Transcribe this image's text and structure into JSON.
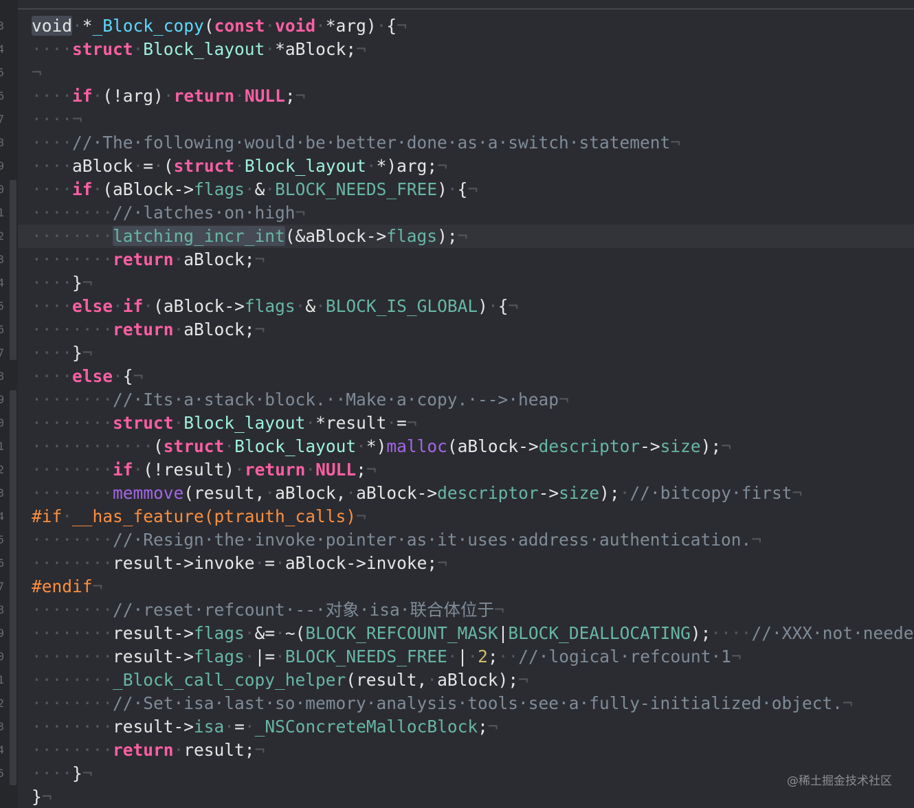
{
  "gutter_numbers": [
    "3",
    "4",
    "5",
    "6",
    "7",
    "8",
    "9",
    "0",
    "1",
    "2",
    "3",
    "4",
    "5",
    "6",
    "7",
    "8",
    "9",
    "0",
    "1",
    "2",
    "3",
    "4",
    "5",
    "6",
    "7",
    "8",
    "9",
    "0",
    "1",
    "2",
    "3",
    "4",
    "5"
  ],
  "current_line_index": 9,
  "code_lines": [
    [
      [
        "pl",
        "void",
        1
      ],
      [
        "ws",
        "·"
      ],
      [
        "pl",
        "*"
      ],
      [
        "ty",
        "_Block_copy"
      ],
      [
        "pl",
        "("
      ],
      [
        "kw",
        "const"
      ],
      [
        "ws",
        "·"
      ],
      [
        "kw",
        "void"
      ],
      [
        "ws",
        "·"
      ],
      [
        "pl",
        "*arg)"
      ],
      [
        "ws",
        "·"
      ],
      [
        "pl",
        "{"
      ],
      [
        "ws",
        "¬"
      ]
    ],
    [
      [
        "ws",
        "····"
      ],
      [
        "kw",
        "struct"
      ],
      [
        "ws",
        "·"
      ],
      [
        "tyc",
        "Block_layout"
      ],
      [
        "ws",
        "·"
      ],
      [
        "pl",
        "*aBlock;"
      ],
      [
        "ws",
        "¬"
      ]
    ],
    [
      [
        "ws",
        "¬"
      ]
    ],
    [
      [
        "ws",
        "····"
      ],
      [
        "kw",
        "if"
      ],
      [
        "ws",
        "·"
      ],
      [
        "pl",
        "(!arg)"
      ],
      [
        "ws",
        "·"
      ],
      [
        "kw",
        "return"
      ],
      [
        "ws",
        "·"
      ],
      [
        "kw",
        "NULL"
      ],
      [
        "pl",
        ";"
      ],
      [
        "ws",
        "¬"
      ]
    ],
    [
      [
        "ws",
        "····¬"
      ]
    ],
    [
      [
        "ws",
        "····"
      ],
      [
        "cm",
        "//·The·following·would·be·better·done·as·a·switch·statement"
      ],
      [
        "ws",
        "¬"
      ]
    ],
    [
      [
        "ws",
        "····"
      ],
      [
        "pl",
        "aBlock"
      ],
      [
        "ws",
        "·"
      ],
      [
        "pl",
        "="
      ],
      [
        "ws",
        "·"
      ],
      [
        "pl",
        "("
      ],
      [
        "kw",
        "struct"
      ],
      [
        "ws",
        "·"
      ],
      [
        "tyc",
        "Block_layout"
      ],
      [
        "ws",
        "·"
      ],
      [
        "pl",
        "*)arg;"
      ],
      [
        "ws",
        "¬"
      ]
    ],
    [
      [
        "ws",
        "····"
      ],
      [
        "kw",
        "if"
      ],
      [
        "ws",
        "·"
      ],
      [
        "pl",
        "(aBlock->"
      ],
      [
        "fld",
        "flags"
      ],
      [
        "ws",
        "·"
      ],
      [
        "pl",
        "&"
      ],
      [
        "ws",
        "·"
      ],
      [
        "mac",
        "BLOCK_NEEDS_FREE"
      ],
      [
        "pl",
        ")"
      ],
      [
        "ws",
        "·"
      ],
      [
        "pl",
        "{"
      ],
      [
        "ws",
        "¬"
      ]
    ],
    [
      [
        "ws",
        "········"
      ],
      [
        "cm",
        "//·latches·on·high"
      ],
      [
        "ws",
        "¬"
      ]
    ],
    [
      [
        "ws",
        "········"
      ],
      [
        "fn",
        "latching_incr_int",
        1
      ],
      [
        "pl",
        "(&aBlock->"
      ],
      [
        "fld",
        "flags"
      ],
      [
        "pl",
        ");"
      ],
      [
        "ws",
        "¬"
      ]
    ],
    [
      [
        "ws",
        "········"
      ],
      [
        "kw",
        "return"
      ],
      [
        "ws",
        "·"
      ],
      [
        "pl",
        "aBlock;"
      ],
      [
        "ws",
        "¬"
      ]
    ],
    [
      [
        "ws",
        "····"
      ],
      [
        "pl",
        "}"
      ],
      [
        "ws",
        "¬"
      ]
    ],
    [
      [
        "ws",
        "····"
      ],
      [
        "kw",
        "else"
      ],
      [
        "ws",
        "·"
      ],
      [
        "kw",
        "if"
      ],
      [
        "ws",
        "·"
      ],
      [
        "pl",
        "(aBlock->"
      ],
      [
        "fld",
        "flags"
      ],
      [
        "ws",
        "·"
      ],
      [
        "pl",
        "&"
      ],
      [
        "ws",
        "·"
      ],
      [
        "mac",
        "BLOCK_IS_GLOBAL"
      ],
      [
        "pl",
        ")"
      ],
      [
        "ws",
        "·"
      ],
      [
        "pl",
        "{"
      ],
      [
        "ws",
        "¬"
      ]
    ],
    [
      [
        "ws",
        "········"
      ],
      [
        "kw",
        "return"
      ],
      [
        "ws",
        "·"
      ],
      [
        "pl",
        "aBlock;"
      ],
      [
        "ws",
        "¬"
      ]
    ],
    [
      [
        "ws",
        "····"
      ],
      [
        "pl",
        "}"
      ],
      [
        "ws",
        "¬"
      ]
    ],
    [
      [
        "ws",
        "····"
      ],
      [
        "kw",
        "else"
      ],
      [
        "ws",
        "·"
      ],
      [
        "pl",
        "{"
      ],
      [
        "ws",
        "¬"
      ]
    ],
    [
      [
        "ws",
        "········"
      ],
      [
        "cm",
        "//·Its·a·stack·block.··Make·a·copy.·-->·heap"
      ],
      [
        "ws",
        "¬"
      ]
    ],
    [
      [
        "ws",
        "········"
      ],
      [
        "kw",
        "struct"
      ],
      [
        "ws",
        "·"
      ],
      [
        "tyc",
        "Block_layout"
      ],
      [
        "ws",
        "·"
      ],
      [
        "pl",
        "*result"
      ],
      [
        "ws",
        "·"
      ],
      [
        "pl",
        "="
      ],
      [
        "ws",
        "¬"
      ]
    ],
    [
      [
        "ws",
        "············"
      ],
      [
        "pl",
        "("
      ],
      [
        "kw",
        "struct"
      ],
      [
        "ws",
        "·"
      ],
      [
        "tyc",
        "Block_layout"
      ],
      [
        "ws",
        "·"
      ],
      [
        "pl",
        "*)"
      ],
      [
        "sysfn",
        "malloc"
      ],
      [
        "pl",
        "(aBlock->"
      ],
      [
        "fld",
        "descriptor"
      ],
      [
        "pl",
        "->"
      ],
      [
        "fld",
        "size"
      ],
      [
        "pl",
        ");"
      ],
      [
        "ws",
        "¬"
      ]
    ],
    [
      [
        "ws",
        "········"
      ],
      [
        "kw",
        "if"
      ],
      [
        "ws",
        "·"
      ],
      [
        "pl",
        "(!result)"
      ],
      [
        "ws",
        "·"
      ],
      [
        "kw",
        "return"
      ],
      [
        "ws",
        "·"
      ],
      [
        "kw",
        "NULL"
      ],
      [
        "pl",
        ";"
      ],
      [
        "ws",
        "¬"
      ]
    ],
    [
      [
        "ws",
        "········"
      ],
      [
        "sysfn",
        "memmove"
      ],
      [
        "pl",
        "(result,"
      ],
      [
        "ws",
        "·"
      ],
      [
        "pl",
        "aBlock,"
      ],
      [
        "ws",
        "·"
      ],
      [
        "pl",
        "aBlock->"
      ],
      [
        "fld",
        "descriptor"
      ],
      [
        "pl",
        "->"
      ],
      [
        "fld",
        "size"
      ],
      [
        "pl",
        ");"
      ],
      [
        "ws",
        "·"
      ],
      [
        "cm",
        "//·bitcopy·first"
      ],
      [
        "ws",
        "¬"
      ]
    ],
    [
      [
        "pre",
        "#if"
      ],
      [
        "ws",
        "·"
      ],
      [
        "pre",
        "__has_feature(ptrauth_calls)"
      ],
      [
        "ws",
        "¬"
      ]
    ],
    [
      [
        "ws",
        "········"
      ],
      [
        "cm",
        "//·Resign·the·invoke·pointer·as·it·uses·address·authentication."
      ],
      [
        "ws",
        "¬"
      ]
    ],
    [
      [
        "ws",
        "········"
      ],
      [
        "pl",
        "result->invoke"
      ],
      [
        "ws",
        "·"
      ],
      [
        "pl",
        "="
      ],
      [
        "ws",
        "·"
      ],
      [
        "pl",
        "aBlock->invoke;"
      ],
      [
        "ws",
        "¬"
      ]
    ],
    [
      [
        "pre",
        "#endif"
      ],
      [
        "ws",
        "¬"
      ]
    ],
    [
      [
        "ws",
        "········"
      ],
      [
        "cm",
        "//·reset·refcount·--·对象·isa·联合体位于"
      ],
      [
        "ws",
        "¬"
      ]
    ],
    [
      [
        "ws",
        "········"
      ],
      [
        "pl",
        "result->"
      ],
      [
        "fld",
        "flags"
      ],
      [
        "ws",
        "·"
      ],
      [
        "pl",
        "&="
      ],
      [
        "ws",
        "·"
      ],
      [
        "pl",
        "~("
      ],
      [
        "mac",
        "BLOCK_REFCOUNT_MASK"
      ],
      [
        "pl",
        "|"
      ],
      [
        "mac",
        "BLOCK_DEALLOCATING"
      ],
      [
        "pl",
        ");"
      ],
      [
        "ws",
        "····"
      ],
      [
        "cm",
        "//·XXX·not·needed"
      ]
    ],
    [
      [
        "ws",
        "········"
      ],
      [
        "pl",
        "result->"
      ],
      [
        "fld",
        "flags"
      ],
      [
        "ws",
        "·"
      ],
      [
        "pl",
        "|="
      ],
      [
        "ws",
        "·"
      ],
      [
        "mac",
        "BLOCK_NEEDS_FREE"
      ],
      [
        "ws",
        "·"
      ],
      [
        "pl",
        "|"
      ],
      [
        "ws",
        "·"
      ],
      [
        "num",
        "2"
      ],
      [
        "pl",
        ";"
      ],
      [
        "ws",
        "··"
      ],
      [
        "cm",
        "//·logical·refcount·1"
      ],
      [
        "ws",
        "¬"
      ]
    ],
    [
      [
        "ws",
        "········"
      ],
      [
        "fn",
        "_Block_call_copy_helper"
      ],
      [
        "pl",
        "(result,"
      ],
      [
        "ws",
        "·"
      ],
      [
        "pl",
        "aBlock);"
      ],
      [
        "ws",
        "¬"
      ]
    ],
    [
      [
        "ws",
        "········"
      ],
      [
        "cm",
        "//·Set·isa·last·so·memory·analysis·tools·see·a·fully-initialized·object."
      ],
      [
        "ws",
        "¬"
      ]
    ],
    [
      [
        "ws",
        "········"
      ],
      [
        "pl",
        "result->"
      ],
      [
        "fld",
        "isa"
      ],
      [
        "ws",
        "·"
      ],
      [
        "pl",
        "="
      ],
      [
        "ws",
        "·"
      ],
      [
        "mac",
        "_NSConcreteMallocBlock"
      ],
      [
        "pl",
        ";"
      ],
      [
        "ws",
        "¬"
      ]
    ],
    [
      [
        "ws",
        "········"
      ],
      [
        "kw",
        "return"
      ],
      [
        "ws",
        "·"
      ],
      [
        "pl",
        "result;"
      ],
      [
        "ws",
        "¬"
      ]
    ],
    [
      [
        "ws",
        "····"
      ],
      [
        "pl",
        "}"
      ],
      [
        "ws",
        "¬"
      ]
    ],
    [
      [
        "pl",
        "}"
      ],
      [
        "ws",
        "¬"
      ]
    ]
  ],
  "watermark": "@稀土掘金技术社区",
  "colors": {
    "background": "#2b2c31",
    "keyword": "#fc5fa3",
    "type": "#5dd8ff",
    "type_class": "#9ef1dd",
    "function": "#67b7a4",
    "system_function": "#a167e6",
    "preprocessor": "#fd8f3f",
    "comment": "#7f8c98",
    "number": "#d0bf69"
  }
}
